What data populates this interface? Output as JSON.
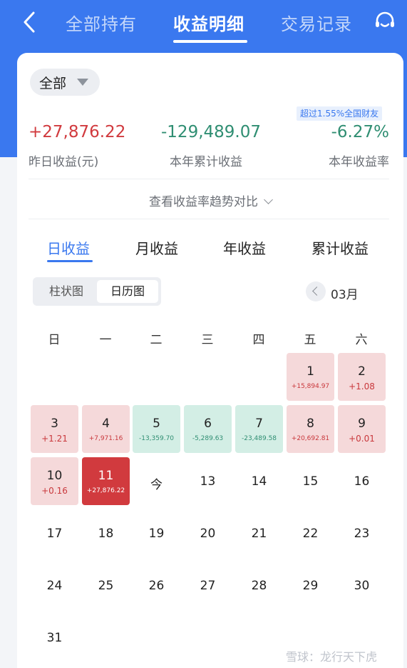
{
  "nav": {
    "tabs": [
      "全部持有",
      "收益明细",
      "交易记录"
    ],
    "active_tab": "收益明细"
  },
  "filter": {
    "label": "全部"
  },
  "rank_badge": "超过1.55%全国财友",
  "stats": [
    {
      "value": "+27,876.22",
      "label": "昨日收益(元)"
    },
    {
      "value": "-129,489.07",
      "label": "本年累计收益"
    },
    {
      "value": "-6.27%",
      "label": "本年收益率"
    }
  ],
  "trend_link": "查看收益率趋势对比",
  "sub_tabs": [
    "日收益",
    "月收益",
    "年收益",
    "累计收益"
  ],
  "view_toggle": [
    "柱状图",
    "日历图"
  ],
  "month": "03月",
  "weekdays": [
    "日",
    "一",
    "二",
    "三",
    "四",
    "五",
    "六"
  ],
  "days": [
    {
      "day": "1",
      "value": "+15,894.97"
    },
    {
      "day": "2",
      "value": "+1.08"
    },
    {
      "day": "3",
      "value": "+1.21"
    },
    {
      "day": "4",
      "value": "+7,971.16"
    },
    {
      "day": "5",
      "value": "-13,359.70"
    },
    {
      "day": "6",
      "value": "-5,289.63"
    },
    {
      "day": "7",
      "value": "-23,489.58"
    },
    {
      "day": "8",
      "value": "+20,692.81"
    },
    {
      "day": "9",
      "value": "+0.01"
    },
    {
      "day": "10",
      "value": "+0.16"
    },
    {
      "day": "11",
      "value": "+27,876.22"
    },
    {
      "day": "今",
      "value": ""
    },
    {
      "day": "13",
      "value": ""
    },
    {
      "day": "14",
      "value": ""
    },
    {
      "day": "15",
      "value": ""
    },
    {
      "day": "16",
      "value": ""
    },
    {
      "day": "17",
      "value": ""
    },
    {
      "day": "18",
      "value": ""
    },
    {
      "day": "19",
      "value": ""
    },
    {
      "day": "20",
      "value": ""
    },
    {
      "day": "21",
      "value": ""
    },
    {
      "day": "22",
      "value": ""
    },
    {
      "day": "23",
      "value": ""
    },
    {
      "day": "24",
      "value": ""
    },
    {
      "day": "25",
      "value": ""
    },
    {
      "day": "26",
      "value": ""
    },
    {
      "day": "27",
      "value": ""
    },
    {
      "day": "28",
      "value": ""
    },
    {
      "day": "29",
      "value": ""
    },
    {
      "day": "30",
      "value": ""
    },
    {
      "day": "31",
      "value": ""
    }
  ],
  "watermark": "雪球：龙行天下虎",
  "colors": {
    "primary": "#3a78ef",
    "gain": "#d13a3e",
    "loss": "#2f8e72",
    "gain_bg": "#f5d9da",
    "loss_bg": "#d3eee5"
  }
}
